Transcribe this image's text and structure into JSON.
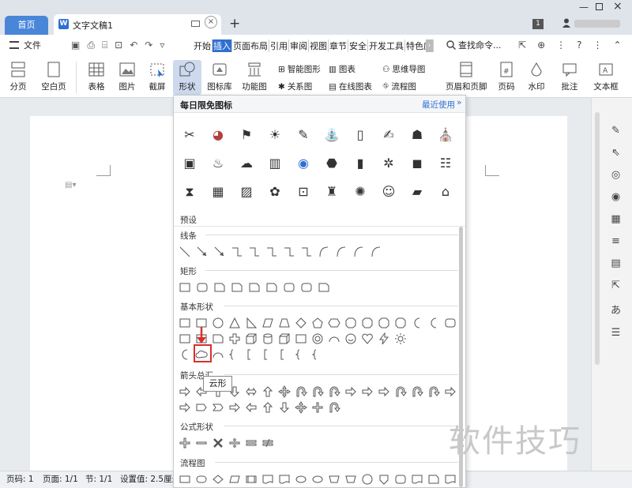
{
  "tabs": {
    "home": "首页",
    "doc": "文字文稿1",
    "add": "+",
    "window_badge": "1"
  },
  "menu": {
    "file": "文件",
    "items": [
      "开始",
      "插入",
      "页面布局",
      "引用",
      "审阅",
      "视图",
      "章节",
      "安全",
      "开发工具",
      "特色应"
    ],
    "active_index": 1,
    "search": "查找命令..."
  },
  "ribbon": {
    "pagebreak": "分页",
    "blank": "空白页",
    "table": "表格",
    "picture": "图片",
    "screenshot": "截屏",
    "shape": "形状",
    "iconlib": "图标库",
    "funcchart": "功能图",
    "smartart": "智能图形",
    "chart": "图表",
    "relation": "关系图",
    "onlinechart": "在线图表",
    "mindmap": "思维导图",
    "flowchart": "流程图",
    "headerfooter": "页眉和页脚",
    "pagenum": "页码",
    "watermark": "水印",
    "comment": "批注",
    "textbox": "文本框"
  },
  "dropdown": {
    "header": "每日限免图标",
    "recent": "最近使用",
    "preset": "预设",
    "lines": "线条",
    "rect": "矩形",
    "basic": "基本形状",
    "arrows": "箭头总汇",
    "formula": "公式形状",
    "flow": "流程图",
    "tooltip": "云形"
  },
  "status": {
    "page_num": "页码: 1",
    "pages": "页面: 1/1",
    "section": "节: 1/1",
    "setting": "设置值: 2.5厘米"
  },
  "watermark_text": "软件技巧",
  "colors": {
    "accent": "#2f6fd1",
    "highlight": "#d9302a",
    "hometab": "#4a86d8"
  }
}
